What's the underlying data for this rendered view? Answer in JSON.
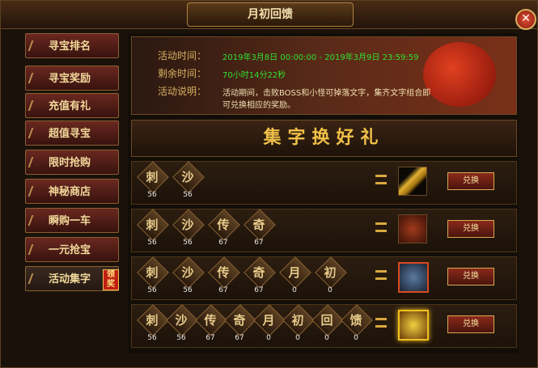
{
  "window": {
    "title": "月初回馈",
    "close_label": "✕"
  },
  "sidebar": {
    "items": [
      {
        "label": "寻宝排名"
      },
      {
        "label": "寻宝奖励"
      },
      {
        "label": "充值有礼"
      },
      {
        "label": "超值寻宝"
      },
      {
        "label": "限时抢购"
      },
      {
        "label": "神秘商店"
      },
      {
        "label": "瞬购一车"
      },
      {
        "label": "一元抢宝"
      },
      {
        "label": "活动集字",
        "badge": "领奖",
        "active": true
      }
    ]
  },
  "banner": {
    "time_label": "活动时间：",
    "time_value": "2019年3月8日 00:00:00 - 2019年3月9日 23:59:59",
    "remain_label": "剩余时间：",
    "remain_value": "70小时14分22秒",
    "desc_label": "活动说明：",
    "desc_value": "活动期间，击败BOSS和小怪可掉落文字，集齐文字组合即可兑换相应的奖励。"
  },
  "heading": "集字换好礼",
  "combos": [
    {
      "tiles": [
        {
          "ch": "刺",
          "count": "56"
        },
        {
          "ch": "沙",
          "count": "56"
        }
      ],
      "reward_icon": "gold-bar-icon",
      "button": "兑换"
    },
    {
      "tiles": [
        {
          "ch": "刺",
          "count": "56"
        },
        {
          "ch": "沙",
          "count": "56"
        },
        {
          "ch": "传",
          "count": "67"
        },
        {
          "ch": "奇",
          "count": "67"
        }
      ],
      "reward_icon": "red-chest-icon",
      "button": "兑换"
    },
    {
      "tiles": [
        {
          "ch": "刺",
          "count": "56"
        },
        {
          "ch": "沙",
          "count": "56"
        },
        {
          "ch": "传",
          "count": "67"
        },
        {
          "ch": "奇",
          "count": "67"
        },
        {
          "ch": "月",
          "count": "0"
        },
        {
          "ch": "初",
          "count": "0"
        }
      ],
      "reward_icon": "blue-chest-icon",
      "button": "兑换"
    },
    {
      "tiles": [
        {
          "ch": "刺",
          "count": "56"
        },
        {
          "ch": "沙",
          "count": "56"
        },
        {
          "ch": "传",
          "count": "67"
        },
        {
          "ch": "奇",
          "count": "67"
        },
        {
          "ch": "月",
          "count": "0"
        },
        {
          "ch": "初",
          "count": "0"
        },
        {
          "ch": "回",
          "count": "0"
        },
        {
          "ch": "馈",
          "count": "0"
        }
      ],
      "reward_icon": "glowing-treasure-icon",
      "button": "兑换"
    }
  ]
}
